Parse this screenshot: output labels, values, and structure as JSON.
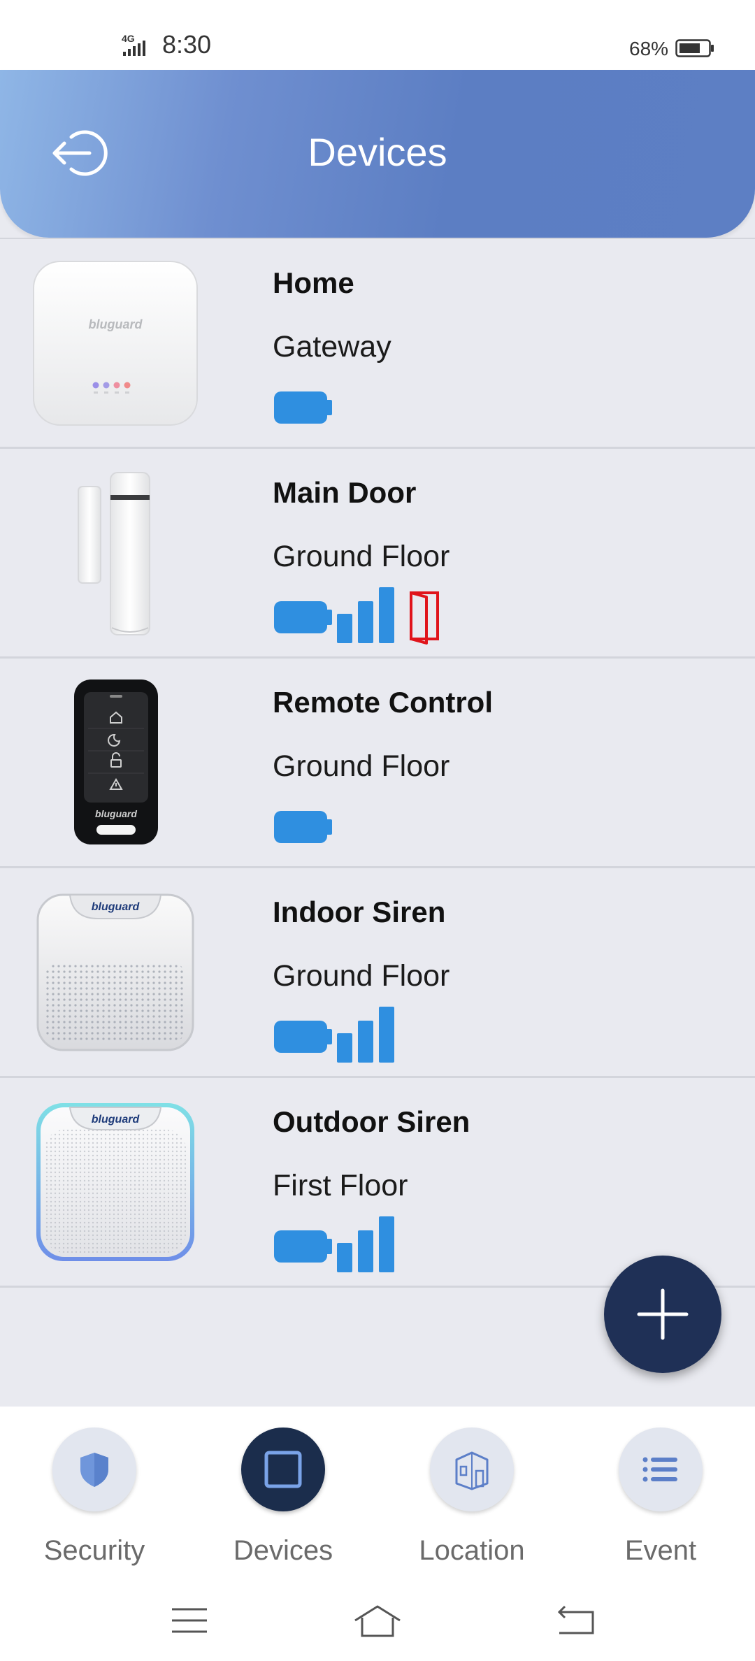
{
  "status_bar": {
    "network": "4G",
    "time": "8:30",
    "battery_percent": "68%"
  },
  "header": {
    "title": "Devices",
    "back_icon": "logout-arrow-icon"
  },
  "colors": {
    "accent_blue": "#2f8fe0",
    "alert_red": "#e0141b",
    "nav_active": "#1b2d4c",
    "fab": "#1f3056"
  },
  "devices": [
    {
      "name": "Home",
      "location": "Gateway",
      "image": "gateway-image",
      "indicators": [
        "battery"
      ]
    },
    {
      "name": "Main Door",
      "location": "Ground Floor",
      "image": "door-sensor-image",
      "indicators": [
        "battery",
        "signal",
        "door-open"
      ]
    },
    {
      "name": "Remote Control",
      "location": "Ground Floor",
      "image": "remote-control-image",
      "indicators": [
        "battery"
      ]
    },
    {
      "name": "Indoor Siren",
      "location": "Ground Floor",
      "image": "indoor-siren-image",
      "indicators": [
        "battery",
        "signal"
      ]
    },
    {
      "name": "Outdoor Siren",
      "location": "First Floor",
      "image": "outdoor-siren-image",
      "indicators": [
        "battery",
        "signal"
      ]
    }
  ],
  "brand_text": "bluguard",
  "fab": {
    "icon": "plus-icon"
  },
  "bottom_nav": [
    {
      "label": "Security",
      "icon": "shield-icon",
      "active": false
    },
    {
      "label": "Devices",
      "icon": "square-icon",
      "active": true
    },
    {
      "label": "Location",
      "icon": "building-icon",
      "active": false
    },
    {
      "label": "Event",
      "icon": "list-icon",
      "active": false
    }
  ],
  "system_nav": [
    "menu-icon",
    "home-icon",
    "back-icon"
  ]
}
